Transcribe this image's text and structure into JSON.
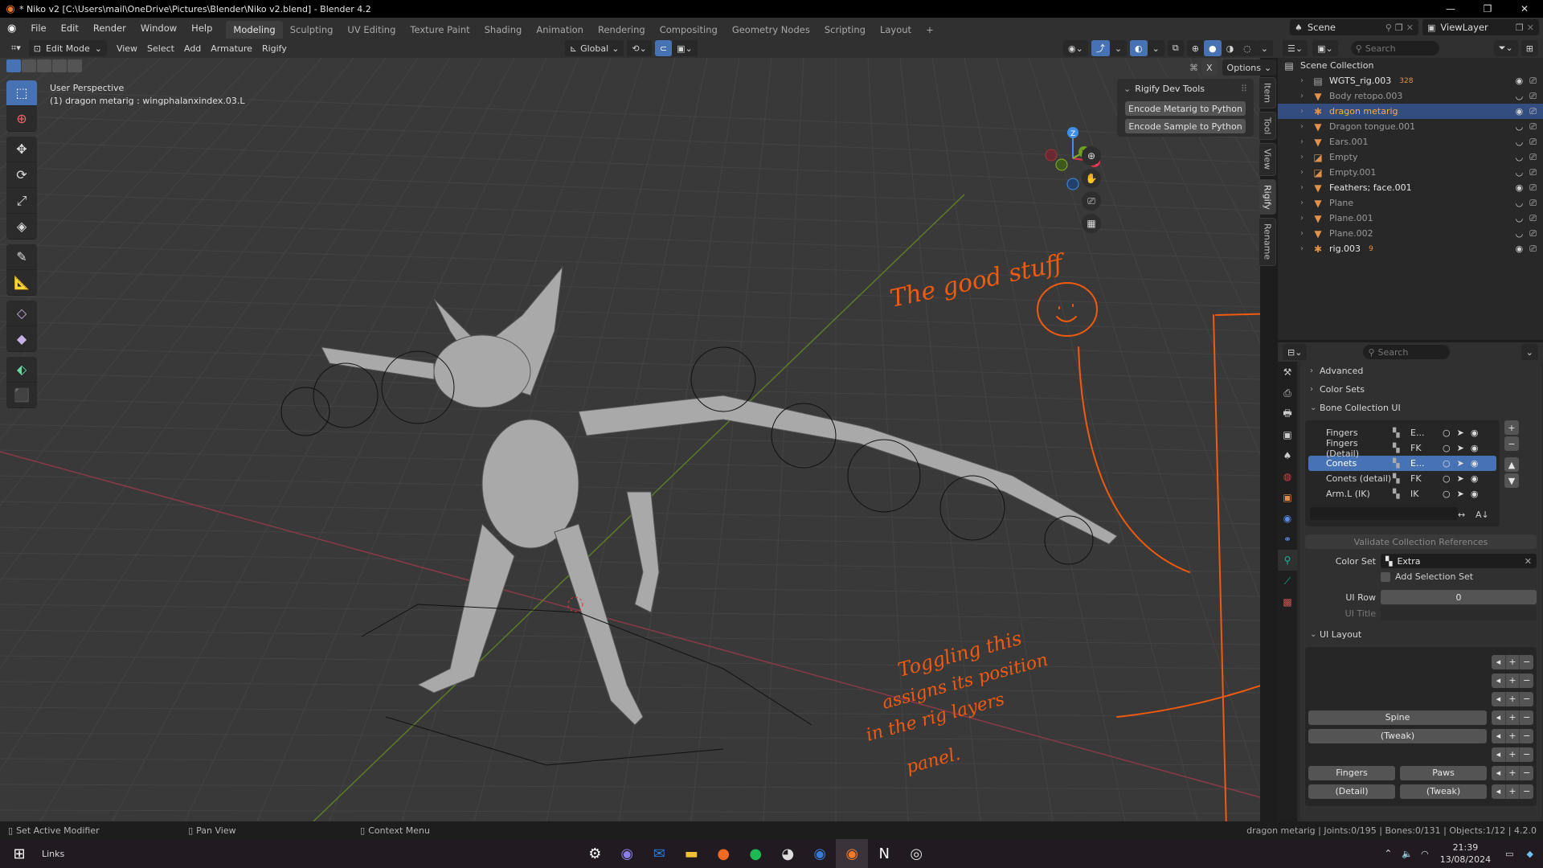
{
  "window": {
    "title": "* Niko v2 [C:\\Users\\mail\\OneDrive\\Pictures\\Blender\\Niko v2.blend] - Blender 4.2",
    "controls": [
      "minimize",
      "maximize",
      "close"
    ]
  },
  "menu": {
    "items": [
      "File",
      "Edit",
      "Render",
      "Window",
      "Help"
    ],
    "workspaces": [
      "Modeling",
      "Sculpting",
      "UV Editing",
      "Texture Paint",
      "Shading",
      "Animation",
      "Rendering",
      "Compositing",
      "Geometry Nodes",
      "Scripting",
      "Layout",
      "+"
    ],
    "active_workspace": "Modeling",
    "scene": "Scene",
    "view_layer": "ViewLayer"
  },
  "viewport_header": {
    "mode": "Edit Mode",
    "menus": [
      "View",
      "Select",
      "Add",
      "Armature",
      "Rigify"
    ],
    "orientation": "Global",
    "options_label": "Options",
    "x_mirror": "X"
  },
  "viewport": {
    "perspective": "User Perspective",
    "active": "(1) dragon metarig : wingphalanxindex.03.L",
    "gizmo_axes": [
      "Z",
      "Y",
      "X"
    ],
    "tools": [
      "select-box",
      "cursor",
      "move",
      "rotate",
      "scale",
      "transform",
      "annotate",
      "measure",
      "bone-roll",
      "bone-size",
      "extrude",
      "envelope"
    ]
  },
  "npanel": {
    "title": "Rigify Dev Tools",
    "buttons": [
      "Encode Metarig to Python",
      "Encode Sample to Python"
    ],
    "tabs": [
      "Item",
      "Tool",
      "View",
      "Rigify",
      "Rename"
    ],
    "active_tab": "Rigify"
  },
  "outliner": {
    "search_placeholder": "Search",
    "root": "Scene Collection",
    "rows": [
      {
        "name": "WGTS_rig.003",
        "badge": "328",
        "type": "collection",
        "visible": true
      },
      {
        "name": "Body retopo.003",
        "type": "mesh",
        "visible": false
      },
      {
        "name": "dragon metarig",
        "type": "armature",
        "visible": true,
        "selected": true
      },
      {
        "name": "Dragon tongue.001",
        "type": "mesh",
        "visible": false
      },
      {
        "name": "Ears.001",
        "type": "mesh",
        "visible": false
      },
      {
        "name": "Empty",
        "type": "empty",
        "visible": false
      },
      {
        "name": "Empty.001",
        "type": "empty",
        "visible": false
      },
      {
        "name": "Feathers; face.001",
        "type": "mesh",
        "visible": true
      },
      {
        "name": "Plane",
        "type": "mesh",
        "visible": false
      },
      {
        "name": "Plane.001",
        "type": "mesh",
        "visible": false
      },
      {
        "name": "Plane.002",
        "type": "mesh",
        "visible": false
      },
      {
        "name": "rig.003",
        "type": "armature",
        "visible": true,
        "badge": "9"
      }
    ]
  },
  "properties": {
    "search_placeholder": "Search",
    "sections": [
      "Advanced",
      "Color Sets",
      "Bone Collection UI"
    ],
    "bone_collections": [
      {
        "name": "Fingers",
        "type": "E...",
        "selected": false
      },
      {
        "name": "Fingers (Detail)",
        "type": "FK",
        "selected": false
      },
      {
        "name": "Conets",
        "type": "E...",
        "selected": true
      },
      {
        "name": "Conets (detail)",
        "type": "FK",
        "selected": false
      },
      {
        "name": "Arm.L (IK)",
        "type": "IK",
        "selected": false
      }
    ],
    "validate_label": "Validate Collection References",
    "color_set_label": "Color Set",
    "color_set_value": "Extra",
    "add_selection_set": "Add Selection Set",
    "ui_row_label": "UI Row",
    "ui_row_value": "0",
    "ui_title_label": "UI Title",
    "ui_layout_label": "UI Layout",
    "ui_layout_rows": [
      [],
      [],
      [],
      [
        "Spine"
      ],
      [
        "(Tweak)"
      ],
      [],
      [
        "Fingers",
        "Paws"
      ],
      [
        "(Detail)",
        "(Tweak)"
      ]
    ]
  },
  "statusbar": {
    "left": [
      "Set Active Modifier",
      "Pan View",
      "Context Menu"
    ],
    "right": "dragon metarig | Joints:0/195 | Bones:0/131 | Objects:1/12 | 4.2.0"
  },
  "taskbar": {
    "search_label": "Links",
    "apps": [
      "settings",
      "copilot",
      "outlook",
      "file-explorer",
      "firefox",
      "spotify",
      "app-bee",
      "steam",
      "blender",
      "notion",
      "clip-studio"
    ],
    "active_app": "blender",
    "time": "21:39",
    "date": "13/08/2024"
  },
  "annotations": {
    "note1": "The good stuff",
    "note2": [
      "Toggling this",
      "assigns its position",
      "in the rig layers",
      "panel."
    ]
  }
}
